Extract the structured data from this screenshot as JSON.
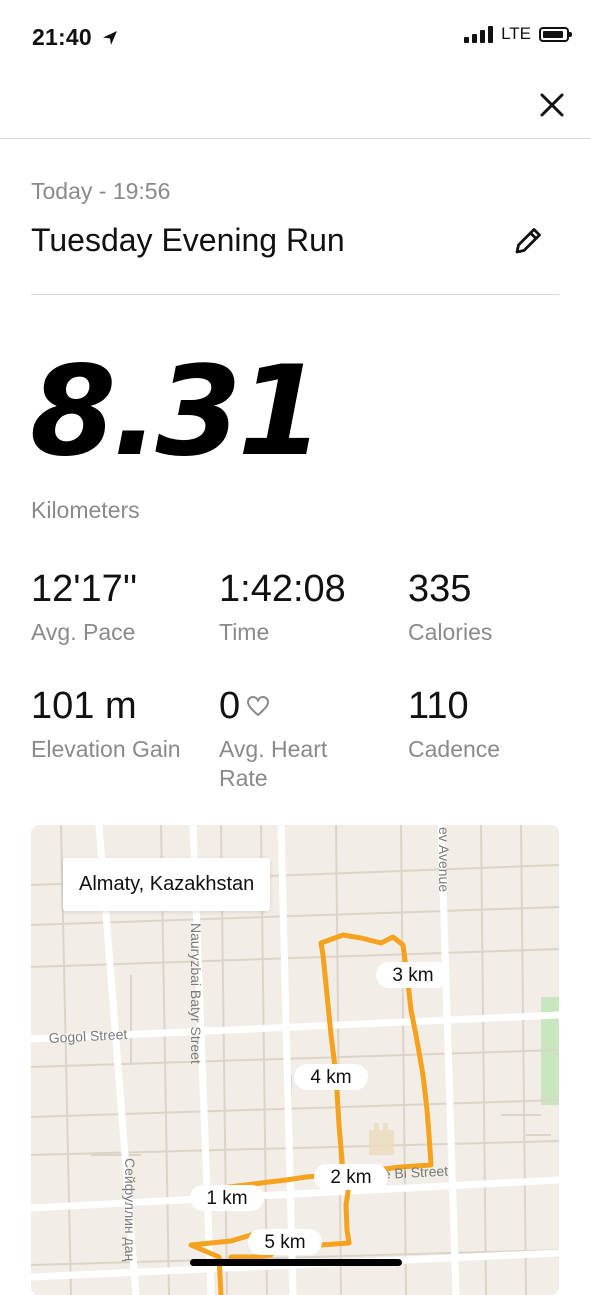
{
  "status": {
    "time": "21:40",
    "network": "LTE"
  },
  "activity": {
    "date": "Today - 19:56",
    "title": "Tuesday Evening Run",
    "distance": "8.31",
    "distance_unit": "Kilometers"
  },
  "stats": [
    {
      "value": "12'17''",
      "label": "Avg. Pace"
    },
    {
      "value": "1:42:08",
      "label": "Time"
    },
    {
      "value": "335",
      "label": "Calories"
    },
    {
      "value": "101 m",
      "label": "Elevation Gain"
    },
    {
      "value": "0",
      "label": "Avg. Heart Rate"
    },
    {
      "value": "110",
      "label": "Cadence"
    }
  ],
  "map": {
    "location": "Almaty, Kazakhstan",
    "streets": {
      "gogol": "Gogol Street",
      "nauryzbai": "Nauryzbai Batyr Street",
      "avenue": "ev Avenue",
      "bottom": "e Bi Street",
      "seifullin": "Сейфуллин даң"
    },
    "markers": [
      "1 km",
      "2 km",
      "3 km",
      "4 km",
      "5 km"
    ],
    "route_color": "#f5a21e"
  }
}
